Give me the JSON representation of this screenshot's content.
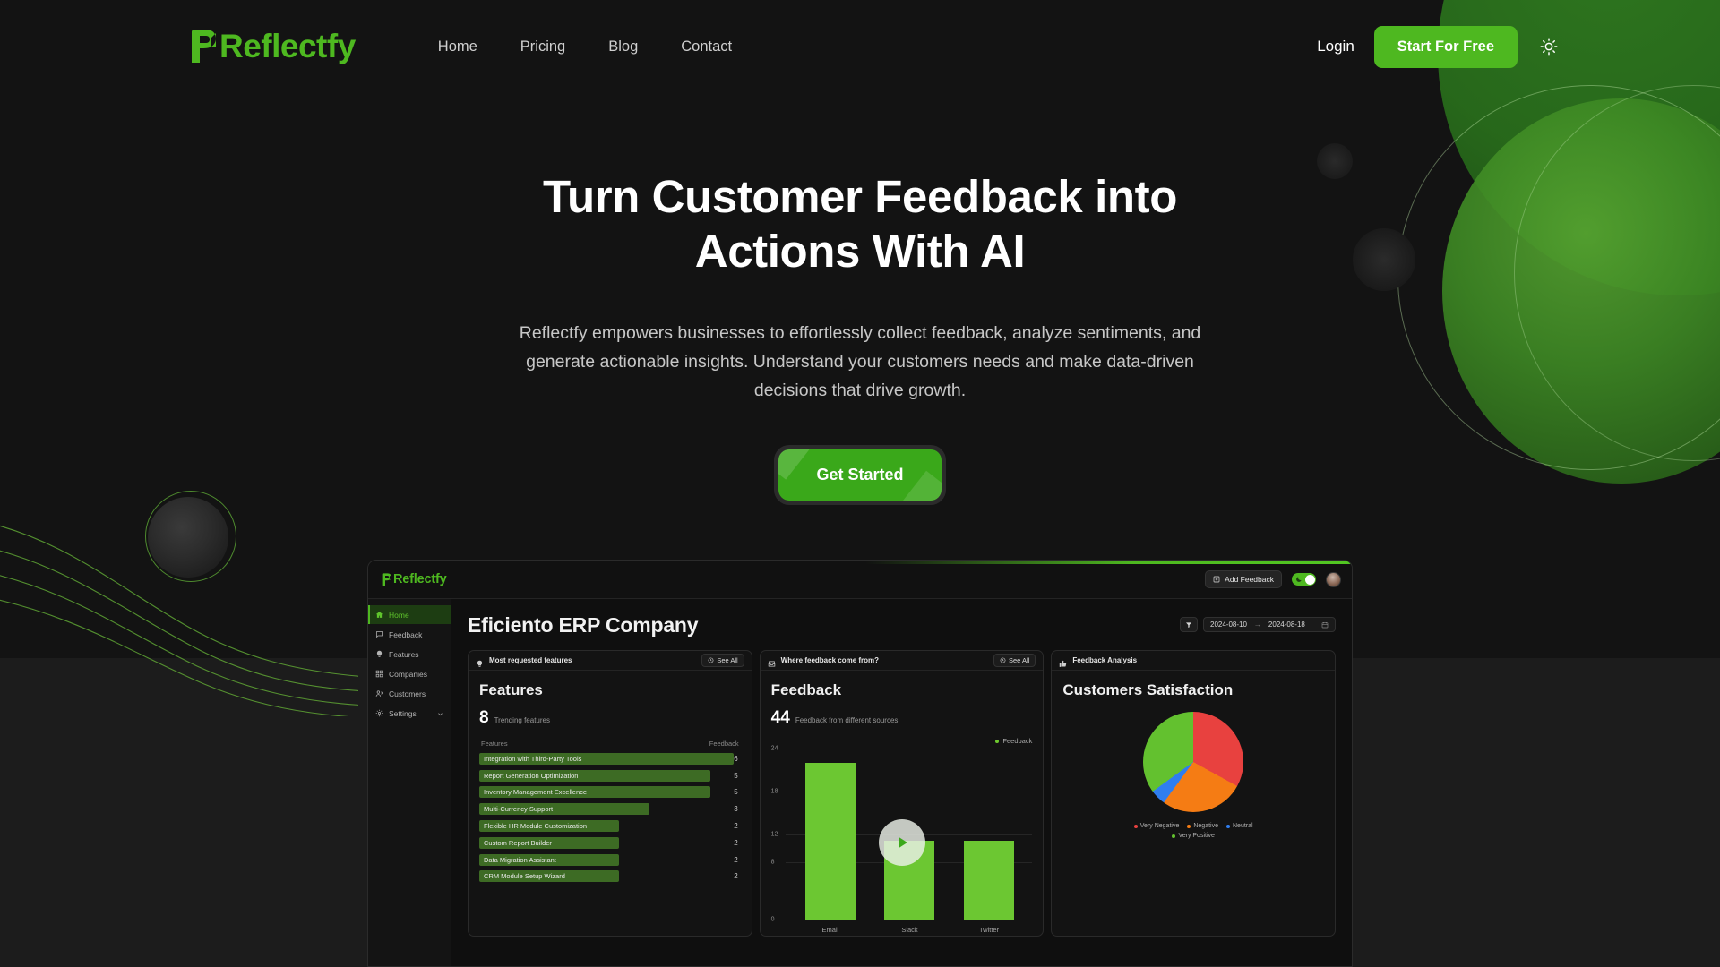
{
  "brand": {
    "name": "Reflectfy",
    "accent": "#4eb820"
  },
  "nav": {
    "links": [
      {
        "label": "Home"
      },
      {
        "label": "Pricing"
      },
      {
        "label": "Blog"
      },
      {
        "label": "Contact"
      }
    ],
    "login_label": "Login",
    "cta_label": "Start For Free",
    "theme_icon": "sun-icon"
  },
  "hero": {
    "heading": "Turn Customer Feedback into Actions With AI",
    "subheading": "Reflectfy empowers businesses to effortlessly collect feedback, analyze sentiments, and generate actionable insights. Understand your customers needs and make data-driven decisions that drive growth.",
    "cta_label": "Get Started"
  },
  "dashboard": {
    "brand": "Reflectfy",
    "add_feedback_label": "Add Feedback",
    "theme_toggle_icon": "moon-icon",
    "avatar": "user-avatar",
    "sidebar": [
      {
        "label": "Home",
        "icon": "home-icon",
        "active": true
      },
      {
        "label": "Feedback",
        "icon": "message-icon",
        "active": false
      },
      {
        "label": "Features",
        "icon": "bulb-icon",
        "active": false
      },
      {
        "label": "Companies",
        "icon": "grid-icon",
        "active": false
      },
      {
        "label": "Customers",
        "icon": "users-icon",
        "active": false
      },
      {
        "label": "Settings",
        "icon": "gear-icon",
        "active": false,
        "chevron": true
      }
    ],
    "page_title": "Eficiento ERP Company",
    "filter_icon": "filter-icon",
    "date_from": "2024-08-10",
    "date_to": "2024-08-18",
    "date_arrow": "→",
    "calendar_icon": "calendar-icon",
    "cards": {
      "features": {
        "head_title": "Most requested features",
        "head_icon": "bulb-icon",
        "see_all": "See All",
        "title": "Features",
        "stat_number": "8",
        "stat_label": "Trending features",
        "col_left": "Features",
        "col_right": "Feedback"
      },
      "feedback": {
        "head_title": "Where feedback come from?",
        "head_icon": "inbox-icon",
        "see_all": "See All",
        "title": "Feedback",
        "stat_number": "44",
        "stat_label": "Feedback from different sources",
        "legend_label": "Feedback",
        "play_icon": "play-icon"
      },
      "analysis": {
        "head_title": "Feedback Analysis",
        "head_icon": "thumbs-up-icon",
        "title": "Customers Satisfaction"
      }
    }
  },
  "chart_data": [
    {
      "type": "bar",
      "title": "Feedback",
      "categories": [
        "Email",
        "Slack",
        "Twitter"
      ],
      "values": [
        22,
        11,
        11
      ],
      "series": [
        {
          "name": "Feedback",
          "values": [
            22,
            11,
            11
          ],
          "color": "#6cc732"
        }
      ],
      "xlabel": "",
      "ylabel": "",
      "ylim": [
        0,
        24
      ],
      "yticks": [
        0,
        8,
        12,
        18,
        24
      ],
      "grid": true,
      "legend": "top-right"
    },
    {
      "type": "bar",
      "title": "Features",
      "orientation": "horizontal",
      "categories": [
        "Integration with Third-Party Tools",
        "Report Generation Optimization",
        "Inventory Management Excellence",
        "Multi-Currency Support",
        "Flexible HR Module Customization",
        "Custom Report Builder",
        "Data Migration Assistant",
        "CRM Module Setup Wizard"
      ],
      "values": [
        6,
        5,
        5,
        3,
        2,
        2,
        2,
        2
      ],
      "xlabel": "Feedback",
      "ylabel": "Features",
      "ylim": [
        0,
        6
      ],
      "grid": false,
      "color": "#3d6b24"
    },
    {
      "type": "pie",
      "title": "Customers Satisfaction",
      "categories": [
        "Very Negative",
        "Negative",
        "Neutral",
        "Very Positive"
      ],
      "values": [
        33,
        27,
        5,
        35
      ],
      "colors": [
        "#e8413f",
        "#f57c14",
        "#2f7ef0",
        "#63c12f"
      ],
      "legend": "bottom"
    }
  ]
}
